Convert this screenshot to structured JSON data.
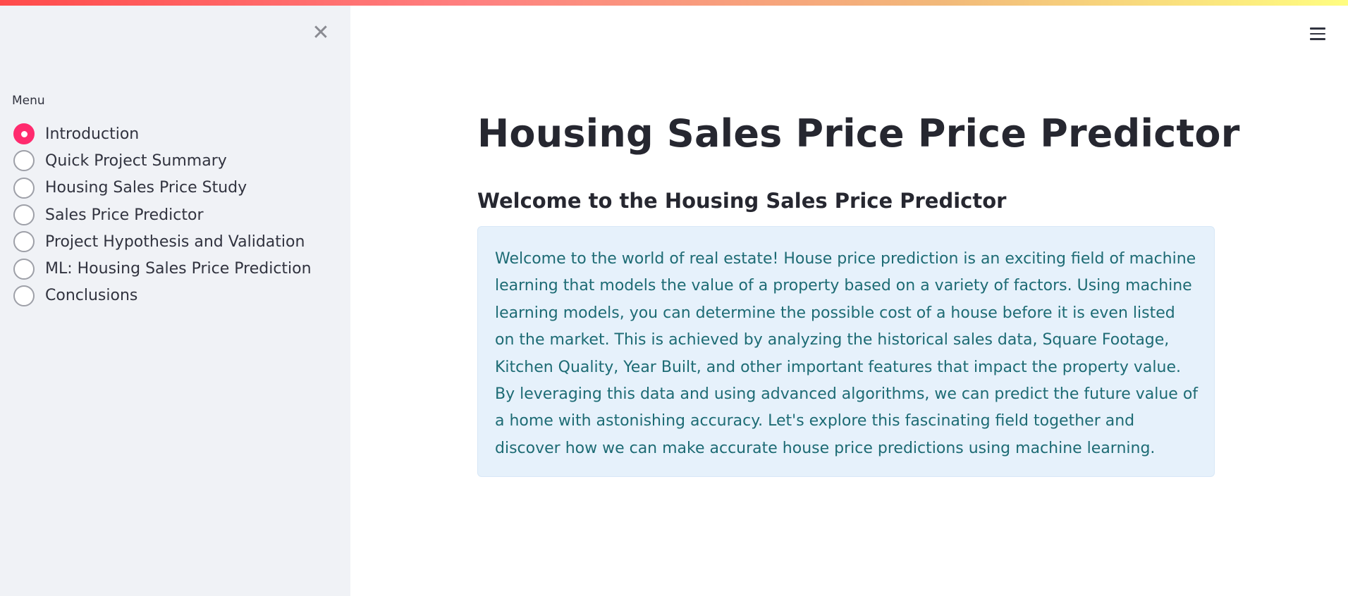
{
  "sidebar": {
    "close_glyph": "✕",
    "menu_label": "Menu",
    "items": [
      {
        "label": "Introduction",
        "selected": true
      },
      {
        "label": "Quick Project Summary",
        "selected": false
      },
      {
        "label": "Housing Sales Price Study",
        "selected": false
      },
      {
        "label": "Sales Price Predictor",
        "selected": false
      },
      {
        "label": "Project Hypothesis and Validation",
        "selected": false
      },
      {
        "label": "ML: Housing Sales Price Prediction",
        "selected": false
      },
      {
        "label": "Conclusions",
        "selected": false
      }
    ]
  },
  "main": {
    "title": "Housing Sales Price Price Predictor",
    "subtitle": "Welcome to the Housing Sales Price Predictor",
    "info_text": "Welcome to the world of real estate! House price prediction is an exciting field of machine learning that models the value of a property based on a variety of factors. Using machine learning models, you can determine the possible cost of a house before it is even listed on the market. This is achieved by analyzing the historical sales data, Square Footage, Kitchen Quality, Year Built, and other important features that impact the property value. By leveraging this data and using advanced algorithms, we can predict the future value of a home with astonishing accuracy. Let's explore this fascinating field together and discover how we can make accurate house price predictions using machine learning."
  },
  "icons": {
    "close": "close-icon",
    "menu": "hamburger-menu-icon"
  },
  "colors": {
    "accent": "#ff2b6e",
    "sidebar_bg": "#f0f2f6",
    "info_bg": "#e6f1fb",
    "info_text": "#1d6b74"
  }
}
